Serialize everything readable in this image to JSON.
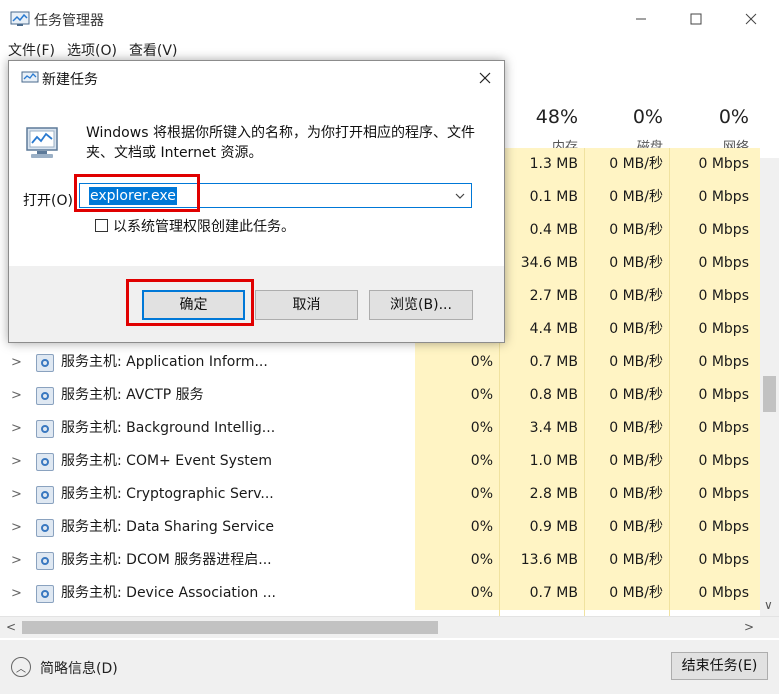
{
  "window": {
    "title": "任务管理器",
    "menu": [
      "文件(F)",
      "选项(O)",
      "查看(V)"
    ],
    "controls": {
      "minimize": "—",
      "maximize": "☐",
      "close": "✕"
    }
  },
  "columns": [
    {
      "pct": "48%",
      "name": "内存"
    },
    {
      "pct": "0%",
      "name": "磁盘"
    },
    {
      "pct": "0%",
      "name": "网络"
    }
  ],
  "rows": [
    {
      "name": "",
      "cpu": "",
      "mem": "1.3 MB",
      "disk": "0 MB/秒",
      "net": "0 Mbps"
    },
    {
      "name": "",
      "cpu": "",
      "mem": "0.1 MB",
      "disk": "0 MB/秒",
      "net": "0 Mbps"
    },
    {
      "name": "",
      "cpu": "",
      "mem": "0.4 MB",
      "disk": "0 MB/秒",
      "net": "0 Mbps"
    },
    {
      "name": "",
      "cpu": "",
      "mem": "34.6 MB",
      "disk": "0 MB/秒",
      "net": "0 Mbps"
    },
    {
      "name": "",
      "cpu": "",
      "mem": "2.7 MB",
      "disk": "0 MB/秒",
      "net": "0 Mbps"
    },
    {
      "name": "",
      "cpu": "",
      "mem": "4.4 MB",
      "disk": "0 MB/秒",
      "net": "0 Mbps"
    },
    {
      "name": "服务主机: Application Inform...",
      "cpu": "0%",
      "mem": "0.7 MB",
      "disk": "0 MB/秒",
      "net": "0 Mbps"
    },
    {
      "name": "服务主机: AVCTP 服务",
      "cpu": "0%",
      "mem": "0.8 MB",
      "disk": "0 MB/秒",
      "net": "0 Mbps"
    },
    {
      "name": "服务主机: Background Intellig...",
      "cpu": "0%",
      "mem": "3.4 MB",
      "disk": "0 MB/秒",
      "net": "0 Mbps"
    },
    {
      "name": "服务主机: COM+ Event System",
      "cpu": "0%",
      "mem": "1.0 MB",
      "disk": "0 MB/秒",
      "net": "0 Mbps"
    },
    {
      "name": "服务主机: Cryptographic Serv...",
      "cpu": "0%",
      "mem": "2.8 MB",
      "disk": "0 MB/秒",
      "net": "0 Mbps"
    },
    {
      "name": "服务主机: Data Sharing Service",
      "cpu": "0%",
      "mem": "0.9 MB",
      "disk": "0 MB/秒",
      "net": "0 Mbps"
    },
    {
      "name": "服务主机: DCOM 服务器进程启...",
      "cpu": "0%",
      "mem": "13.6 MB",
      "disk": "0 MB/秒",
      "net": "0 Mbps"
    },
    {
      "name": "服务主机: Device Association ...",
      "cpu": "0%",
      "mem": "0.7 MB",
      "disk": "0 MB/秒",
      "net": "0 Mbps"
    }
  ],
  "footer": {
    "fewer_details": "简略信息(D)",
    "end_task": "结束任务(E)"
  },
  "dialog": {
    "title": "新建任务",
    "description": "Windows 将根据你所键入的名称，为你打开相应的程序、文件夹、文档或 Internet 资源。",
    "open_label": "打开(O):",
    "open_value": "explorer.exe",
    "admin_checkbox": "以系统管理权限创建此任务。",
    "ok": "确定",
    "cancel": "取消",
    "browse": "浏览(B)..."
  },
  "accent": "#0078d7",
  "highlight_color": "#e00000"
}
